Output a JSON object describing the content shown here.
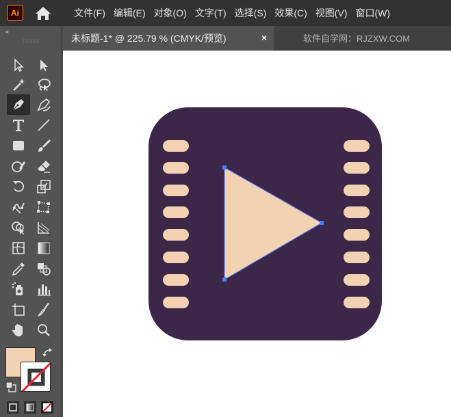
{
  "app": {
    "logo_text": "Ai",
    "menu": [
      "文件(F)",
      "编辑(E)",
      "对象(O)",
      "文字(T)",
      "选择(S)",
      "效果(C)",
      "视图(V)",
      "窗口(W)"
    ]
  },
  "tab": {
    "label": "未标题-1* @ 225.79 % (CMYK/预览)",
    "close": "×",
    "watermark": "软件自学网：RJZXW.COM"
  },
  "toolbar": {
    "collapse": "‹‹",
    "tools": [
      "selection-tool",
      "direct-selection-tool",
      "magic-wand-tool",
      "lasso-tool",
      "pen-tool",
      "curvature-tool",
      "type-tool",
      "line-segment-tool",
      "rectangle-tool",
      "paintbrush-tool",
      "shaper-tool",
      "eraser-tool",
      "rotate-tool",
      "scale-tool",
      "puppet-warp-tool",
      "free-transform-tool",
      "shape-builder-tool",
      "perspective-grid-tool",
      "mesh-tool",
      "gradient-tool",
      "eyedropper-tool",
      "blend-tool",
      "symbol-sprayer-tool",
      "column-graph-tool",
      "artboard-tool",
      "slice-tool",
      "hand-tool",
      "zoom-tool"
    ],
    "active_tool": "pen-tool"
  },
  "colors": {
    "fill": "#f2d2b2",
    "stroke": "none",
    "icon_bg": "#3d2749",
    "icon_accent": "#f2d2b2",
    "selection": "#4a7bff"
  }
}
